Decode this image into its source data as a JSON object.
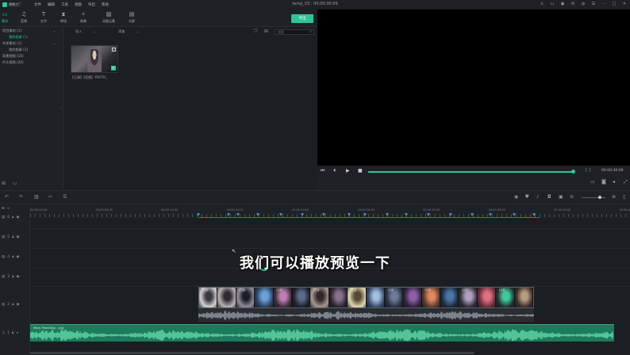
{
  "app": {
    "logo_text": "视频工厂",
    "menu": [
      "文件",
      "编辑",
      "工具",
      "视图",
      "导出",
      "帮助"
    ],
    "doc_title": "temp_03 :  00:00:30:09"
  },
  "library": {
    "tabs": [
      {
        "label": "素材",
        "icon": "folder-icon"
      },
      {
        "label": "音频",
        "icon": "music-note-icon"
      },
      {
        "label": "文字",
        "icon": "text-icon"
      },
      {
        "label": "转场",
        "icon": "transition-icon"
      },
      {
        "label": "效果",
        "icon": "effects-icon"
      },
      {
        "label": "动画元素",
        "icon": "elements-icon"
      },
      {
        "label": "分屏",
        "icon": "split-screen-icon"
      }
    ],
    "export_label": "导出",
    "tree": [
      {
        "label": "项目素材 (1)",
        "selected": false
      },
      {
        "label": "我的相册 (1)",
        "selected": true
      },
      {
        "label": "共享素材 (1)",
        "selected": false
      },
      {
        "label": "我的相册 (1)",
        "selected": false
      },
      {
        "label": "背景视频 (15)",
        "selected": false
      },
      {
        "label": "片头视频 (20)",
        "selected": false
      }
    ],
    "sort_label": "导入",
    "filter_label": "添加",
    "search_placeholder": "搜索",
    "media_items": [
      {
        "label": "【王源】【音频】YOUTH_"
      }
    ]
  },
  "player": {
    "timecode": "00:00:30:09",
    "braces": "{ }",
    "progress": 0.995
  },
  "ruler": {
    "ticks": [
      "00:00:00:00",
      "00:00:05:00",
      "00:00:10:00",
      "00:00:15:00",
      "00:00:20:00",
      "00:00:25:00",
      "00:00:30:00",
      "00:00:35:00",
      "00:00:40:00",
      "00:00:45:00"
    ]
  },
  "tracks": {
    "labels": [
      "6",
      "5",
      "4",
      "3",
      "2",
      "1",
      "1"
    ],
    "frame_tag": "【王源",
    "audio_clip_name": "Mary Fired Boy - July"
  },
  "overlay": {
    "subtitle": "我们可以播放预览一下"
  },
  "colors": {
    "accent": "#2fc59a",
    "marker": "#3a8ee6",
    "range": "#c33a3a"
  }
}
